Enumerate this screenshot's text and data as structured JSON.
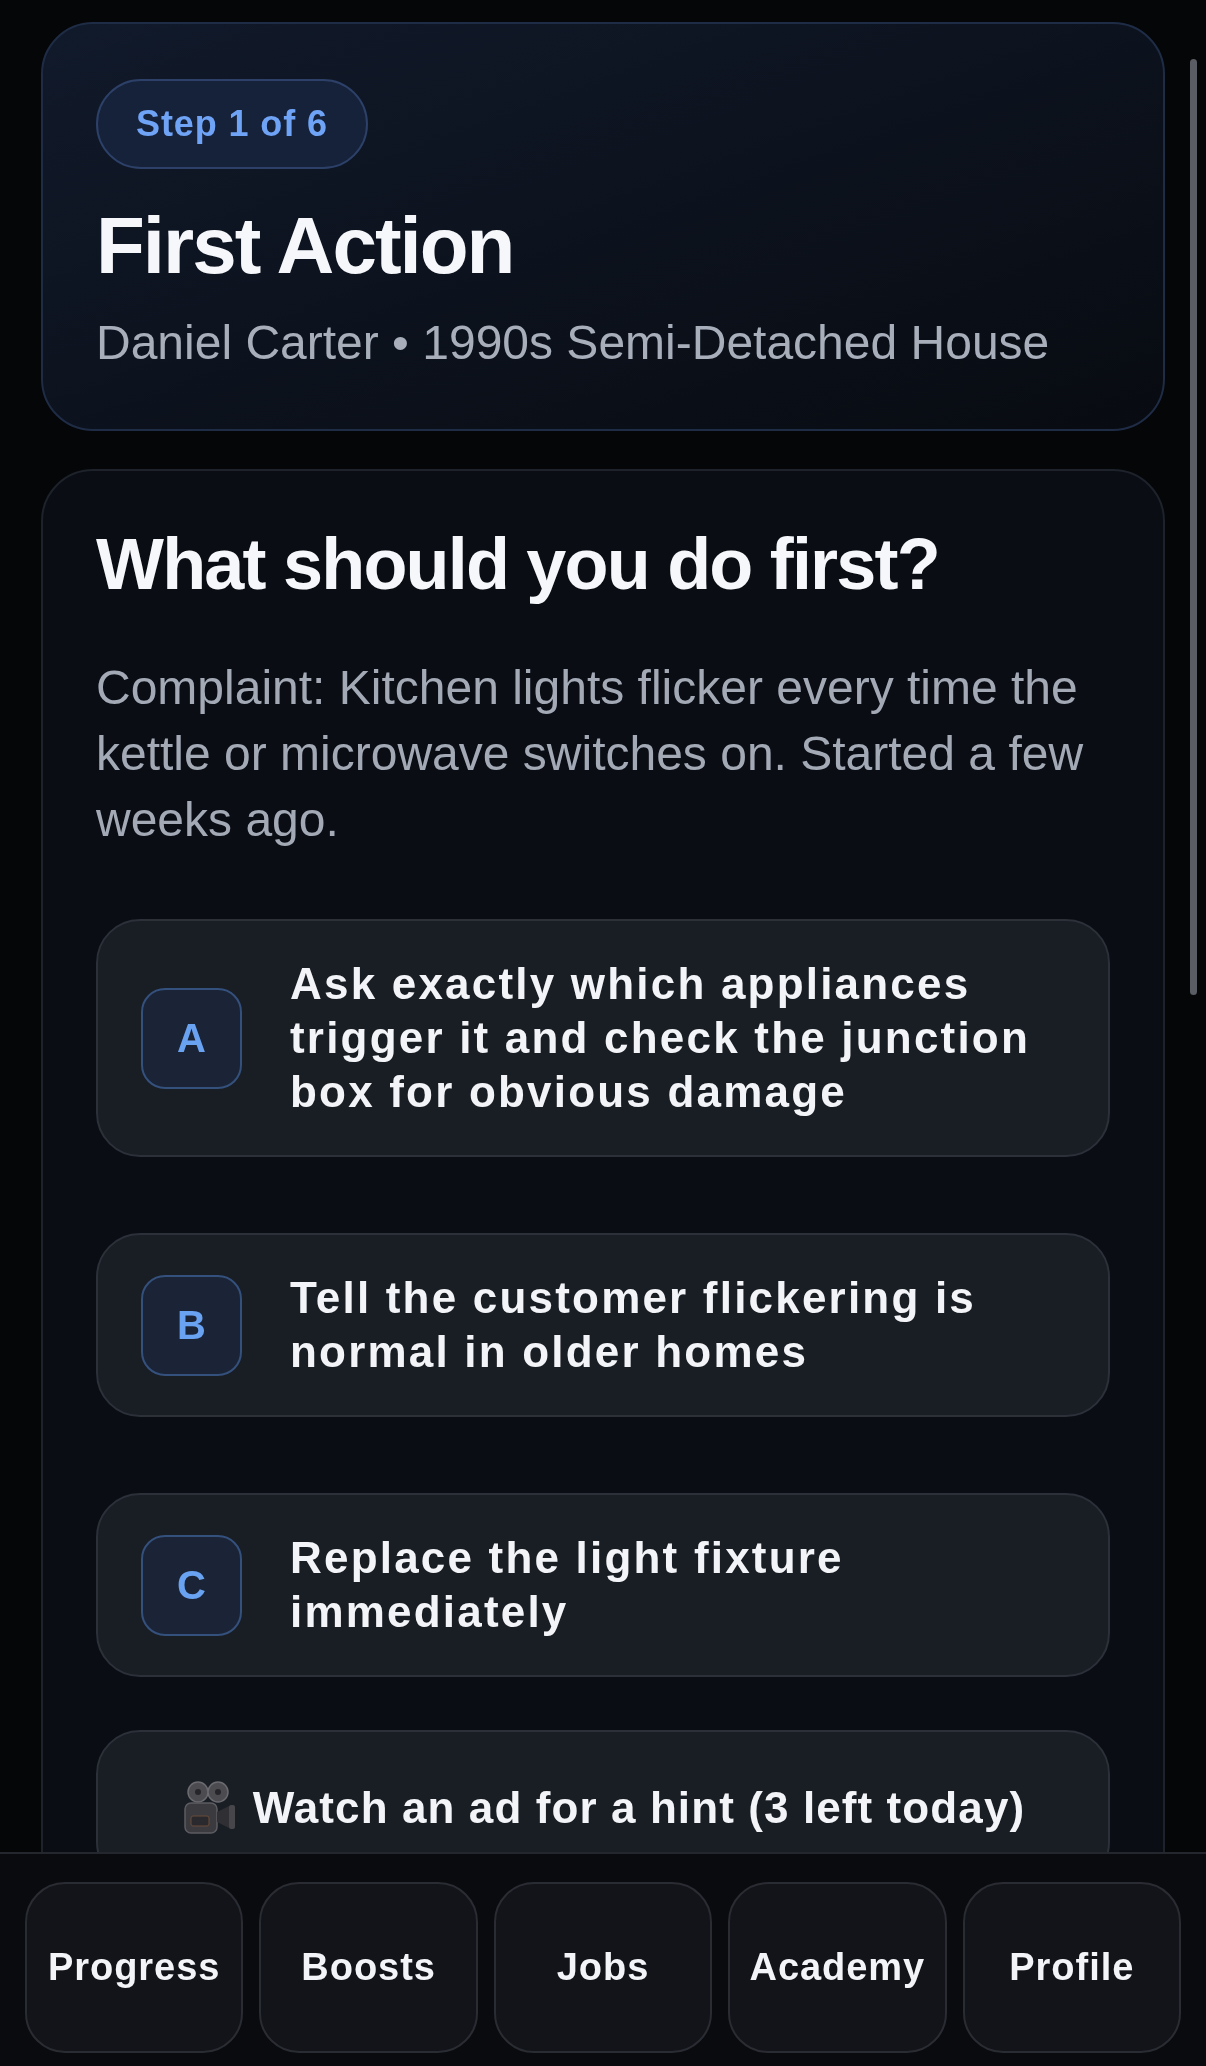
{
  "header": {
    "step_badge": "Step 1 of 6",
    "title": "First Action",
    "subtitle": "Daniel Carter • 1990s Semi-Detached House"
  },
  "question": {
    "title": "What should you do first?",
    "complaint": "Complaint: Kitchen lights flicker every time the kettle or microwave switches on. Started a few weeks ago.",
    "options": [
      {
        "letter": "A",
        "text": "Ask exactly which appliances trigger it and check the junction box for obvious damage",
        "selected": false
      },
      {
        "letter": "B",
        "text": "Tell the customer flickering is normal in older homes",
        "selected": false
      },
      {
        "letter": "C",
        "text": "Replace the light fixture immediately",
        "selected": false
      }
    ],
    "hint_button": "Watch an ad for a hint (3 left today)"
  },
  "bottom_nav": [
    {
      "label": "Progress",
      "selected": false
    },
    {
      "label": "Boosts",
      "selected": false
    },
    {
      "label": "Jobs",
      "selected": false
    },
    {
      "label": "Academy",
      "selected": false
    },
    {
      "label": "Profile",
      "selected": false
    }
  ]
}
